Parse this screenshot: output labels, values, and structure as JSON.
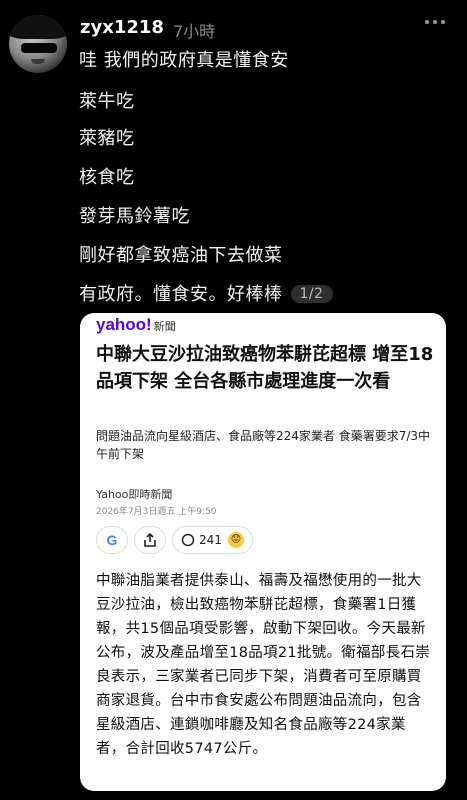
{
  "post": {
    "username": "zyx1218",
    "time": "7小時",
    "lines": [
      "哇 我們的政府真是懂食安",
      "萊牛吃",
      "萊豬吃",
      "核食吃",
      "發芽馬鈴薯吃",
      "剛好都拿致癌油下去做菜",
      "有政府。懂食安。好棒棒"
    ],
    "image_counter": "1/2"
  },
  "card": {
    "brand": "yahoo!",
    "brand_sub": "新聞",
    "headline": "中聯大豆沙拉油致癌物苯駢芘超標 增至18品項下架 全台各縣市處理進度一次看",
    "subline": "問題油品流向星級酒店、食品廠等224家業者 食藥署要求7/3中午前下架",
    "source": "Yahoo即時新聞",
    "date": "2026年7月3日週五 上午9:50",
    "comment_count": "241",
    "body": "中聯油脂業者提供泰山、福壽及福懋使用的一批大豆沙拉油，檢出致癌物苯駢芘超標，食藥署1日獲報，共15個品項受影響，啟動下架回收。今天最新公布，波及產品增至18品項21批號。衛福部長石崇良表示，三家業者已同步下架，消費者可至原購買商家退貨。台中市食安處公布問題油品流向，包含星級酒店、連鎖咖啡廳及知名食品廠等224家業者，合計回收5747公斤。"
  },
  "colors": {
    "background": "#000000",
    "yahoo_purple": "#5f01d1",
    "muted": "#8a8a8a"
  },
  "icons": [
    "more-icon",
    "google-icon",
    "share-icon",
    "comment-icon",
    "reaction-icon"
  ]
}
